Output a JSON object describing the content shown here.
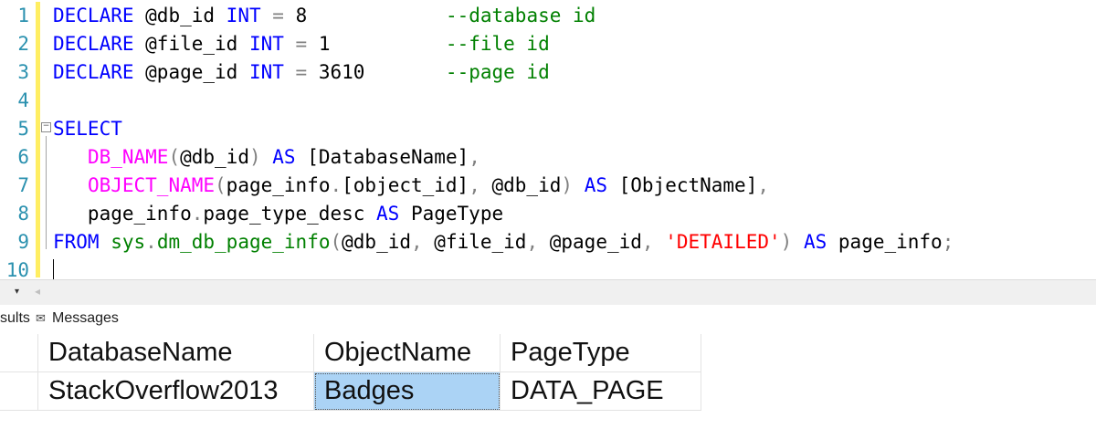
{
  "editor": {
    "line_numbers": [
      "1",
      "2",
      "3",
      "4",
      "5",
      "6",
      "7",
      "8",
      "9",
      "10"
    ],
    "fold_glyph": "⊟",
    "lines": [
      [
        {
          "t": "DECLARE",
          "c": "kw"
        },
        {
          "t": " @db_id ",
          "c": ""
        },
        {
          "t": "INT",
          "c": "kw"
        },
        {
          "t": " ",
          "c": ""
        },
        {
          "t": "=",
          "c": "gray"
        },
        {
          "t": " 8            ",
          "c": ""
        },
        {
          "t": "--database id",
          "c": "cm"
        }
      ],
      [
        {
          "t": "DECLARE",
          "c": "kw"
        },
        {
          "t": " @file_id ",
          "c": ""
        },
        {
          "t": "INT",
          "c": "kw"
        },
        {
          "t": " ",
          "c": ""
        },
        {
          "t": "=",
          "c": "gray"
        },
        {
          "t": " 1          ",
          "c": ""
        },
        {
          "t": "--file id",
          "c": "cm"
        }
      ],
      [
        {
          "t": "DECLARE",
          "c": "kw"
        },
        {
          "t": " @page_id ",
          "c": ""
        },
        {
          "t": "INT",
          "c": "kw"
        },
        {
          "t": " ",
          "c": ""
        },
        {
          "t": "=",
          "c": "gray"
        },
        {
          "t": " 3610       ",
          "c": ""
        },
        {
          "t": "--page id",
          "c": "cm"
        }
      ],
      [],
      [
        {
          "t": "SELECT",
          "c": "kw"
        }
      ],
      [
        {
          "t": "   ",
          "c": ""
        },
        {
          "t": "DB_NAME",
          "c": "fn"
        },
        {
          "t": "(",
          "c": "gray"
        },
        {
          "t": "@db_id",
          "c": ""
        },
        {
          "t": ")",
          "c": "gray"
        },
        {
          "t": " ",
          "c": ""
        },
        {
          "t": "AS",
          "c": "kw"
        },
        {
          "t": " [DatabaseName]",
          "c": ""
        },
        {
          "t": ",",
          "c": "gray"
        }
      ],
      [
        {
          "t": "   ",
          "c": ""
        },
        {
          "t": "OBJECT_NAME",
          "c": "fn"
        },
        {
          "t": "(",
          "c": "gray"
        },
        {
          "t": "page_info",
          "c": ""
        },
        {
          "t": ".",
          "c": "gray"
        },
        {
          "t": "[object_id]",
          "c": ""
        },
        {
          "t": ",",
          "c": "gray"
        },
        {
          "t": " @db_id",
          "c": ""
        },
        {
          "t": ")",
          "c": "gray"
        },
        {
          "t": " ",
          "c": ""
        },
        {
          "t": "AS",
          "c": "kw"
        },
        {
          "t": " [ObjectName]",
          "c": ""
        },
        {
          "t": ",",
          "c": "gray"
        }
      ],
      [
        {
          "t": "   page_info",
          "c": ""
        },
        {
          "t": ".",
          "c": "gray"
        },
        {
          "t": "page_type_desc ",
          "c": ""
        },
        {
          "t": "AS",
          "c": "kw"
        },
        {
          "t": " PageType",
          "c": ""
        }
      ],
      [
        {
          "t": "FROM",
          "c": "kw"
        },
        {
          "t": " ",
          "c": ""
        },
        {
          "t": "sys",
          "c": "sysobj"
        },
        {
          "t": ".",
          "c": "gray"
        },
        {
          "t": "dm_db_page_info",
          "c": "sysobj"
        },
        {
          "t": "(",
          "c": "gray"
        },
        {
          "t": "@db_id",
          "c": ""
        },
        {
          "t": ",",
          "c": "gray"
        },
        {
          "t": " @file_id",
          "c": ""
        },
        {
          "t": ",",
          "c": "gray"
        },
        {
          "t": " @page_id",
          "c": ""
        },
        {
          "t": ",",
          "c": "gray"
        },
        {
          "t": " ",
          "c": ""
        },
        {
          "t": "'DETAILED'",
          "c": "str"
        },
        {
          "t": ")",
          "c": "gray"
        },
        {
          "t": " ",
          "c": ""
        },
        {
          "t": "AS",
          "c": "kw"
        },
        {
          "t": " page_info",
          "c": ""
        },
        {
          "t": ";",
          "c": "gray"
        }
      ],
      []
    ]
  },
  "scrollbar": {
    "zoom_chevron": "▾",
    "left_arrow": "◂"
  },
  "tabs": {
    "results_label": "sults",
    "messages_icon": "✉",
    "messages_label": "Messages"
  },
  "grid": {
    "columns": [
      "DatabaseName",
      "ObjectName",
      "PageType"
    ],
    "rows": [
      [
        "StackOverflow2013",
        "Badges",
        "DATA_PAGE"
      ]
    ]
  }
}
